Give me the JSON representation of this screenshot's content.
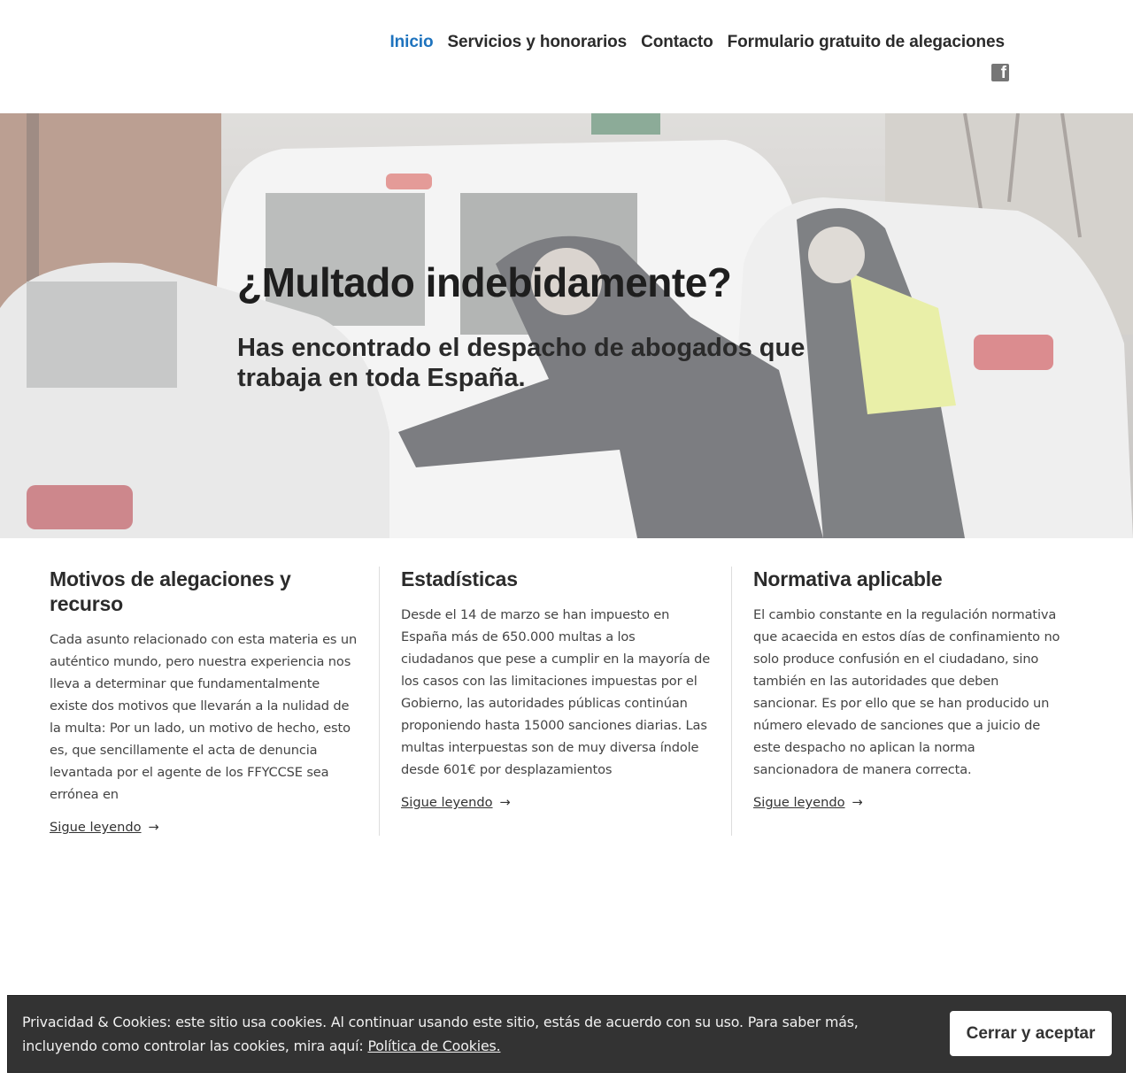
{
  "nav": {
    "items": [
      {
        "label": "Inicio",
        "active": true
      },
      {
        "label": "Servicios y honorarios",
        "active": false
      },
      {
        "label": "Contacto",
        "active": false
      },
      {
        "label": "Formulario gratuito de alegaciones",
        "active": false
      }
    ],
    "social_icon": "facebook-icon",
    "accent_color": "#1e73be"
  },
  "hero": {
    "title": "¿Multado indebidamente?",
    "subtitle": "Has encontrado el despacho de abogados que trabaja en toda España."
  },
  "posts": [
    {
      "title": "Motivos de alegaciones y recurso",
      "excerpt": "Cada asunto relacionado con esta materia es un auténtico mundo, pero nuestra experiencia nos lleva a determinar que fundamentalmente existe dos motivos que llevarán a la nulidad de la multa: Por un lado, un motivo de hecho, esto es, que sencillamente el acta de denuncia levantada por el agente de los FFYCCSE sea errónea en",
      "more": "Sigue leyendo",
      "arrow": "→"
    },
    {
      "title": "Estadísticas",
      "excerpt": "Desde el 14 de marzo se han impuesto en España más de 650.000 multas a los ciudadanos que pese a cumplir en la mayoría de los casos con las limitaciones impuestas por el Gobierno, las autoridades públicas continúan proponiendo hasta 15000 sanciones diarias. Las multas interpuestas son de muy diversa índole desde 601€ por desplazamientos",
      "more": "Sigue leyendo",
      "arrow": "→"
    },
    {
      "title": "Normativa aplicable",
      "excerpt": "El cambio constante en la regulación normativa que acaecida en estos días de confinamiento no solo produce confusión en el ciudadano, sino también en las autoridades que deben sancionar. Es por ello que se han producido un número elevado de sanciones que a juicio de este despacho no aplican la norma sancionadora de manera correcta.",
      "more": "Sigue leyendo",
      "arrow": "→"
    }
  ],
  "cookie": {
    "text": "Privacidad & Cookies: este sitio usa cookies. Al continuar usando este sitio, estás de acuerdo con su uso. Para saber más, incluyendo como controlar las cookies, mira aquí: ",
    "link": "Política de Cookies.",
    "button": "Cerrar y aceptar"
  }
}
